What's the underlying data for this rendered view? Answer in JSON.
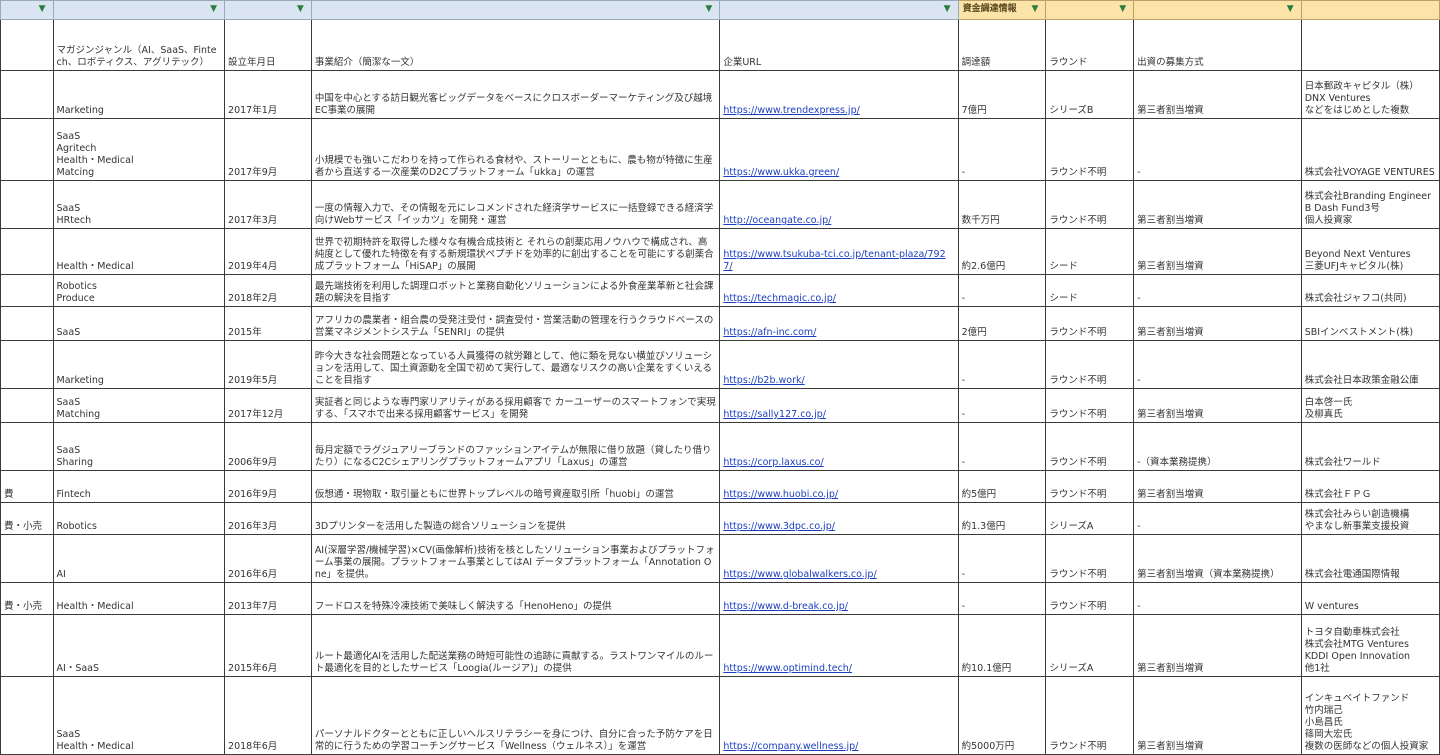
{
  "filter_header": {
    "financing_label": "資金調達情報"
  },
  "headers": [
    "",
    "マガジンジャンル（AI、SaaS、Fintech、ロボティクス、アグリテック）",
    "設立年月日",
    "事業紹介（簡潔な一文）",
    "企業URL",
    "調達額",
    "ラウンド",
    "出資の募集方式",
    ""
  ],
  "rows": [
    {
      "edge": "",
      "genre": "Marketing",
      "date": "2017年1月",
      "desc": "中国を中心とする訪日観光客ビッグデータをベースにクロスボーダーマーケティング及び越境EC事業の展開",
      "url": "https://www.trendexpress.jp/",
      "amount": "7億円",
      "round": "シリーズB",
      "method": "第三者割当増資",
      "investors": "日本郵政キャピタル（株）\nDNX Ventures\nなどをはじめとした複数"
    },
    {
      "edge": "",
      "genre": "SaaS\nAgritech\nHealth・Medical\nMatcing",
      "date": "2017年9月",
      "desc": "小規模でも強いこだわりを持って作られる食材や、ストーリーとともに、農も物が特徴に生産者から直送する一次産業のD2Cプラットフォーム「ukka」の運営",
      "url": "https://www.ukka.green/",
      "amount": "-",
      "round": "ラウンド不明",
      "method": "-",
      "investors": "株式会社VOYAGE VENTURES"
    },
    {
      "edge": "",
      "genre": "SaaS\nHRtech",
      "date": "2017年3月",
      "desc": "一度の情報入力で、その情報を元にレコメンドされた経済学サービスに一括登録できる経済学向けWebサービス「イッカツ」を開発・運営",
      "url": "http://oceangate.co.jp/",
      "amount": "数千万円",
      "round": "ラウンド不明",
      "method": "第三者割当増資",
      "investors": "株式会社Branding Engineer\nB Dash Fund3号\n個人投資家"
    },
    {
      "edge": "",
      "genre": "Health・Medical",
      "date": "2019年4月",
      "desc": "世界で初期特許を取得した様々な有機合成技術と それらの創薬応用ノウハウで構成され、高純度として優れた特徴を有する新規環状ペプチドを効率的に創出することを可能にする創薬合成プラットフォーム「HiSAP」の展開",
      "url": "https://www.tsukuba-tci.co.jp/tenant-plaza/7927/",
      "amount": "約2.6億円",
      "round": "シード",
      "method": "第三者割当増資",
      "investors": "Beyond Next Ventures\n三菱UFJキャピタル(株)"
    },
    {
      "edge": "",
      "genre": "Robotics\nProduce",
      "date": "2018年2月",
      "desc": "最先端技術を利用した調理ロボットと業務自動化ソリューションによる外食産業革新と社会課題の解決を目指す",
      "url": "https://techmagic.co.jp/",
      "amount": "-",
      "round": "シード",
      "method": "-",
      "investors": "株式会社ジャフコ(共同)"
    },
    {
      "edge": "",
      "genre": "SaaS",
      "date": "2015年",
      "desc": "アフリカの農業者・組合農の受発注受付・調査受付・営業活動の管理を行うクラウドベースの営業マネジメントシステム「SENRI」の提供",
      "url": "https://afn-inc.com/",
      "amount": "2億円",
      "round": "ラウンド不明",
      "method": "第三者割当増資",
      "investors": "SBIインベストメント(株)"
    },
    {
      "edge": "",
      "genre": "Marketing",
      "date": "2019年5月",
      "desc": "昨今大きな社会問題となっている人員獲得の就労難として、他に類を見ない横並びソリューションを活用して、国土資源動を全国で初めて実行して、最適なリスクの高い企業をすくいえることを目指す",
      "url": "https://b2b.work/",
      "amount": "-",
      "round": "ラウンド不明",
      "method": "-",
      "investors": "株式会社日本政策金融公庫"
    },
    {
      "edge": "",
      "genre": "SaaS\nMatching",
      "date": "2017年12月",
      "desc": "実証者と同じような専門家リアリティがある採用顧客で カーユーザーのスマートフォンで実現する、「スマホで出来る採用顧客サービス」を開発",
      "url": "https://sally127.co.jp/",
      "amount": "-",
      "round": "ラウンド不明",
      "method": "第三者割当増資",
      "investors": "白本啓一氏\n及柳真氏"
    },
    {
      "edge": "",
      "genre": "SaaS\nSharing",
      "date": "2006年9月",
      "desc": "毎月定額でラグジュアリーブランドのファッションアイテムが無限に借り放題（貸したり借りたり）になるC2Cシェアリングプラットフォームアプリ「Laxus」の運営",
      "url": "https://corp.laxus.co/",
      "amount": "-",
      "round": "ラウンド不明",
      "method": "-（資本業務提携）",
      "investors": "株式会社ワールド"
    },
    {
      "edge": "費",
      "genre": "Fintech",
      "date": "2016年9月",
      "desc": "仮想通・現物取・取引量ともに世界トップレベルの暗号資産取引所「huobi」の運営",
      "url": "https://www.huobi.co.jp/",
      "amount": "約5億円",
      "round": "ラウンド不明",
      "method": "第三者割当増資",
      "investors": "株式会社ＦＰＧ"
    },
    {
      "edge": "費・小売",
      "genre": "Robotics",
      "date": "2016年3月",
      "desc": "3Dプリンターを活用した製造の総合ソリューションを提供",
      "url": "https://www.3dpc.co.jp/",
      "amount": "約1.3億円",
      "round": "シリーズA",
      "method": "-",
      "investors": "株式会社みらい創造機構\nやまなし新事業支援投資"
    },
    {
      "edge": "",
      "genre": "AI",
      "date": "2016年6月",
      "desc": "AI(深層学習/機械学習)×CV(画像解析)技術を核としたソリューション事業およびプラットフォーム事業の展開。プラットフォーム事業としてはAI データプラットフォーム「Annotation One」を提供。",
      "url": "https://www.globalwalkers.co.jp/",
      "amount": "-",
      "round": "ラウンド不明",
      "method": "第三者割当増資（資本業務提携）",
      "investors": "株式会社電通国際情報"
    },
    {
      "edge": "費・小売",
      "genre": "Health・Medical",
      "date": "2013年7月",
      "desc": "フードロスを特殊冷凍技術で美味しく解決する「HenoHeno」の提供",
      "url": "https://www.d-break.co.jp/",
      "amount": "-",
      "round": "ラウンド不明",
      "method": "-",
      "investors": "W ventures"
    },
    {
      "edge": "",
      "genre": "AI・SaaS",
      "date": "2015年6月",
      "desc": "ルート最適化AIを活用した配送業務の時短可能性の追跡に貢献する。ラストワンマイルのルート最適化を目的としたサービス「Loogia(ルージア)」の提供",
      "url": "https://www.optimind.tech/",
      "amount": "約10.1億円",
      "round": "シリーズA",
      "method": "第三者割当増資",
      "investors": "トヨタ自動車株式会社\n株式会社MTG Ventures\nKDDI Open Innovation\n他1社"
    },
    {
      "edge": "",
      "genre": "SaaS\nHealth・Medical",
      "date": "2018年6月",
      "desc": "パーソナルドクターとともに正しいヘルスリテラシーを身につけ、自分に合った予防ケアを日常的に行うための学習コーチングサービス「Wellness（ウェルネス）」を運営",
      "url": "https://company.wellness.jp/",
      "amount": "約5000万円",
      "round": "ラウンド不明",
      "method": "第三者割当増資",
      "investors": "インキュベイトファンド\n竹内瑞己\n小島昌氏\n篠岡大宏氏\n複数の医師などの個人投資家"
    }
  ]
}
